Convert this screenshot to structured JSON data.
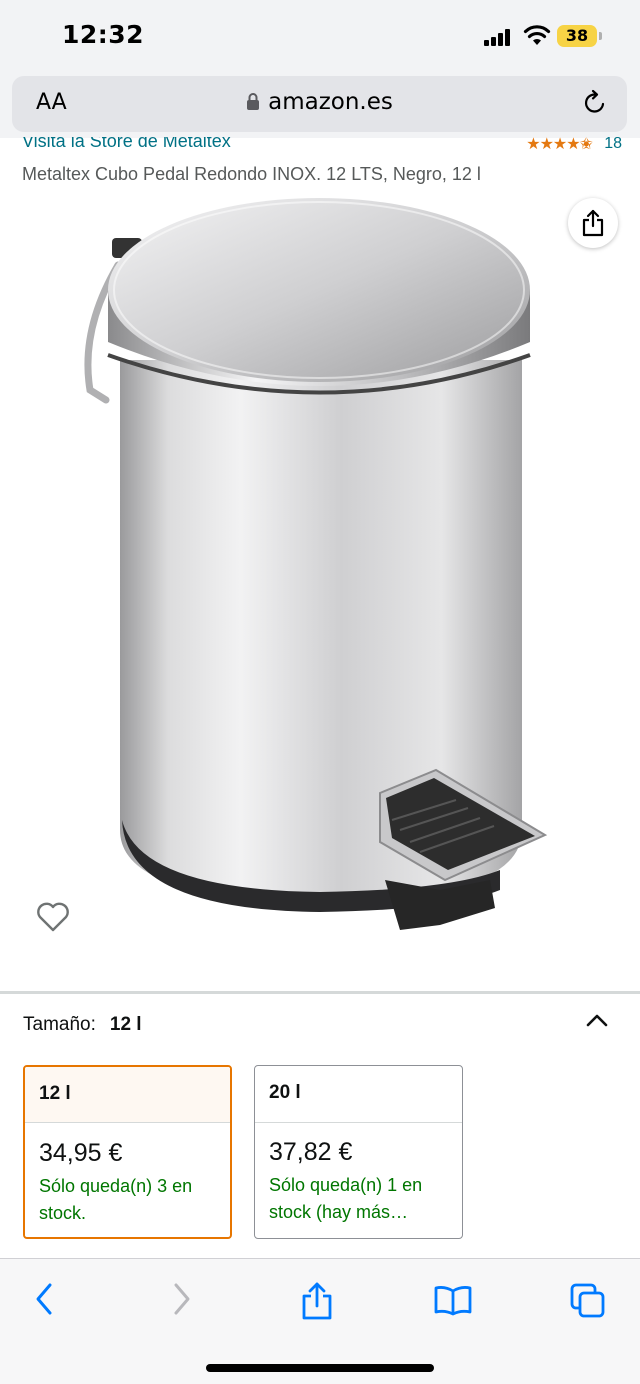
{
  "status_bar": {
    "time": "12:32",
    "battery": "38"
  },
  "url_bar": {
    "text_size_label": "AA",
    "domain": "amazon.es"
  },
  "product": {
    "store_link": "Visita la Store de Metaltex",
    "stars": "★★★★✬",
    "rating_count": "18",
    "title": "Metaltex Cubo Pedal Redondo INOX. 12 LTS, Negro, 12 l"
  },
  "size": {
    "label": "Tamaño:",
    "selected": "12 l",
    "options": [
      {
        "name": "12 l",
        "price": "34,95 €",
        "stock": "Sólo queda(n) 3 en stock."
      },
      {
        "name": "20 l",
        "price": "37,82 €",
        "stock": "Sólo queda(n) 1 en stock (hay más…"
      }
    ]
  },
  "colors": {
    "link": "#007185",
    "stock_green": "#007600",
    "selected_border": "#e77600",
    "ios_blue": "#007aff"
  },
  "icons": {
    "toolbar": [
      "back-icon",
      "forward-icon",
      "share-icon",
      "bookmarks-icon",
      "tabs-icon"
    ]
  }
}
